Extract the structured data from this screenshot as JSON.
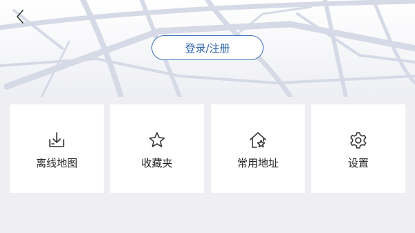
{
  "header": {
    "back_icon": "chevron-left-icon",
    "login_label": "登录/注册",
    "accent_color": "#3f72b8"
  },
  "cards": [
    {
      "label": "离线地图",
      "icon": "download-tray-icon"
    },
    {
      "label": "收藏夹",
      "icon": "star-icon"
    },
    {
      "label": "常用地址",
      "icon": "home-star-icon"
    },
    {
      "label": "设置",
      "icon": "gear-icon"
    }
  ]
}
